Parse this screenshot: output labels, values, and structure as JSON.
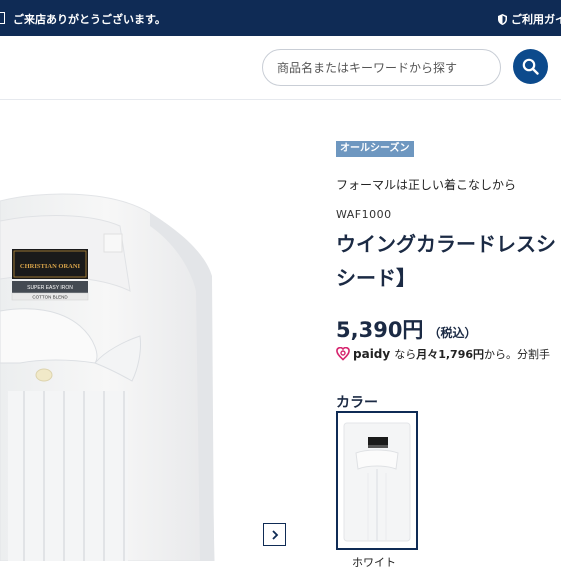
{
  "announcement": {
    "text": "ご来店ありがとうございます。",
    "guide_label": "ご利用ガイ"
  },
  "search": {
    "placeholder": "商品名またはキーワードから探す"
  },
  "gallery": {
    "shirt_label_brand": "CHRISTIAN ORANI",
    "shirt_label_line1": "SUPER EASY IRON",
    "shirt_label_line2": "COTTON BLEND"
  },
  "product": {
    "season_badge": "オールシーズン",
    "tagline": "フォーマルは正しい着こなしから",
    "code": "WAF1000",
    "title_line1": "ウイングカラードレスシ",
    "title_line2": "シード】",
    "price": "5,390円",
    "tax_note": "（税込）",
    "paidy": {
      "brand": "paidy",
      "prefix": "なら",
      "monthly": "月々1,796円",
      "suffix": "から。分割手"
    },
    "color_label": "カラー",
    "colors": [
      {
        "name": "ホワイト"
      }
    ]
  },
  "colors": {
    "navy": "#0f2b55",
    "accent_blue": "#0c4a8c",
    "badge": "#6e97c0",
    "paidy_pink": "#d6246e"
  }
}
